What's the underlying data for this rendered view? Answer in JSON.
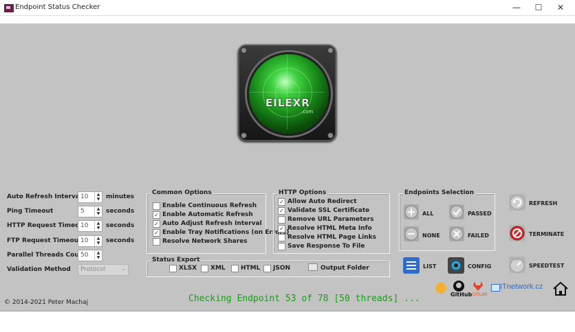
{
  "window": {
    "title": "Endpoint Status Checker",
    "minimize": "—",
    "maximize": "☐",
    "close": "✕"
  },
  "logo": {
    "text": "EILEXR",
    "sub": ".com"
  },
  "settings": {
    "auto_refresh": {
      "label": "Auto Refresh  Interval",
      "value": "10",
      "unit": "minutes"
    },
    "ping_timeout": {
      "label": "Ping Timeout",
      "value": "5",
      "unit": "seconds"
    },
    "http_timeout": {
      "label": "HTTP Request Timeout",
      "value": "10",
      "unit": "seconds"
    },
    "ftp_timeout": {
      "label": "FTP Request Timeout",
      "value": "10",
      "unit": "seconds"
    },
    "threads": {
      "label": "Parallel Threads Count",
      "value": "50"
    },
    "validation": {
      "label": "Validation Method",
      "value": "Protocol"
    }
  },
  "common_options": {
    "title": "Common Options",
    "items": [
      {
        "label": "Enable Continuous Refresh",
        "checked": false
      },
      {
        "label": "Enable Automatic Refresh",
        "checked": true
      },
      {
        "label": "Auto Adjust Refresh Interval",
        "checked": true
      },
      {
        "label": "Enable Tray Notifications (on Errors)",
        "checked": true
      },
      {
        "label": "Resolve Network Shares",
        "checked": false
      }
    ]
  },
  "http_options": {
    "title": "HTTP Options",
    "items": [
      {
        "label": "Allow Auto Redirect",
        "checked": true
      },
      {
        "label": "Validate SSL Certificate",
        "checked": true
      },
      {
        "label": "Remove URL Parameters",
        "checked": false
      },
      {
        "label": "Resolve HTML Meta Info",
        "checked": true
      },
      {
        "label": "Resolve HTML Page Links",
        "checked": false
      },
      {
        "label": "Save Response To File",
        "checked": false
      }
    ]
  },
  "status_export": {
    "title": "Status Export",
    "formats": [
      "XLSX",
      "XML",
      "HTML",
      "JSON"
    ],
    "output_folder": "Output Folder"
  },
  "endpoints_selection": {
    "title": "Endpoints Selection",
    "all": "ALL",
    "passed": "PASSED",
    "none": "NONE",
    "failed": "FAILED"
  },
  "actions": {
    "refresh": "REFRESH",
    "terminate": "TERMINATE",
    "speedtest": "SPEEDTEST",
    "list": "LIST",
    "config": "CONFIG"
  },
  "links": {
    "github": "GitHub",
    "gitlab": "GitLab",
    "itnetwork": "ITnetwork.cz"
  },
  "status": "Checking Endpoint 53 of 78 [50 threads] ...",
  "copyright": "© 2014-2021 Peter Machaj",
  "colors": {
    "background": "#c3c3c3",
    "status_green": "#14a014",
    "accent_blue": "#2f6ec8",
    "terminate_red": "#d62a2a"
  }
}
